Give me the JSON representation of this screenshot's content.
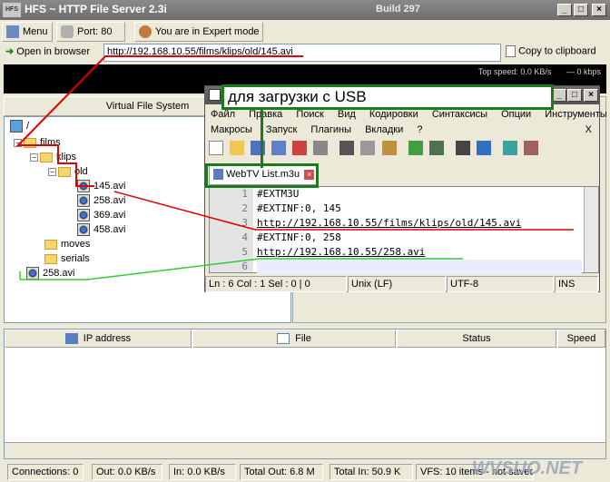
{
  "window": {
    "title": "HFS ~ HTTP File Server 2.3i",
    "build": "Build 297",
    "logo": "HFS"
  },
  "toolbar": {
    "menu": "Menu",
    "port": "Port: 80",
    "expert": "You are in Expert mode"
  },
  "addressbar": {
    "open_label": "Open in browser",
    "url": "http://192.168.10.55/films/klips/old/145.avi",
    "copy_label": "Copy to clipboard"
  },
  "speed": {
    "top_speed": "Top speed: 0.0 KB/s",
    "kbps": "0 kbps"
  },
  "vfs": {
    "header": "Virtual File System",
    "root": "/",
    "folders": [
      "films",
      "klips",
      "old"
    ],
    "old_files": [
      "145.avi",
      "258.avi",
      "369.avi",
      "458.avi"
    ],
    "film_subfolders": [
      "moves",
      "serials"
    ],
    "root_file": "258.avi"
  },
  "annotation": {
    "text": "для загрузки с USB"
  },
  "notepad": {
    "menu": [
      "Файл",
      "Правка",
      "Поиск",
      "Вид",
      "Кодировки",
      "Синтаксисы",
      "Опции",
      "Инструменты",
      "Макросы",
      "Запуск",
      "Плагины",
      "Вкладки",
      "?"
    ],
    "close_x": "X",
    "tab": "WebTV List.m3u",
    "line_numbers": [
      "1",
      "2",
      "3",
      "4",
      "5",
      "6"
    ],
    "lines": [
      "#EXTM3U",
      "#EXTINF:0, 145",
      "http://192.168.10.55/films/klips/old/145.avi",
      "#EXTINF:0, 258",
      "http://192.168.10.55/258.avi",
      ""
    ],
    "status": {
      "pos": "Ln : 6    Col : 1    Sel : 0 | 0",
      "eol": "Unix (LF)",
      "enc": "UTF-8",
      "ins": "INS"
    }
  },
  "log_table": {
    "columns": [
      "IP address",
      "File",
      "Status",
      "Speed"
    ]
  },
  "statusbar": {
    "connections": "Connections: 0",
    "out": "Out: 0.0 KB/s",
    "in": "In: 0.0 KB/s",
    "total_out": "Total Out: 6.8 M",
    "total_in": "Total In: 50.9 K",
    "vfs": "VFS: 10 items - not saved"
  },
  "watermark": "WVSUO.NET",
  "colors": {
    "annotation_green": "#1c7a1c",
    "red_line": "#e00000",
    "green_line": "#33cc33"
  }
}
